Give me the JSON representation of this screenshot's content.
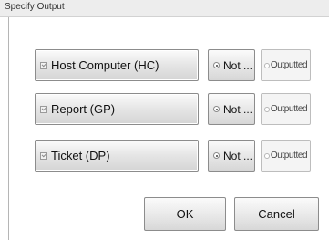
{
  "window": {
    "title": "Specify Output"
  },
  "outputs": [
    {
      "label": "Host Computer (HC)",
      "not_label": "Not ...",
      "outputted_label": "Outputted"
    },
    {
      "label": "Report (GP)",
      "not_label": "Not ...",
      "outputted_label": "Outputted"
    },
    {
      "label": "Ticket (DP)",
      "not_label": "Not ...",
      "outputted_label": "Outputted"
    }
  ],
  "actions": {
    "ok_label": "OK",
    "cancel_label": "Cancel"
  }
}
